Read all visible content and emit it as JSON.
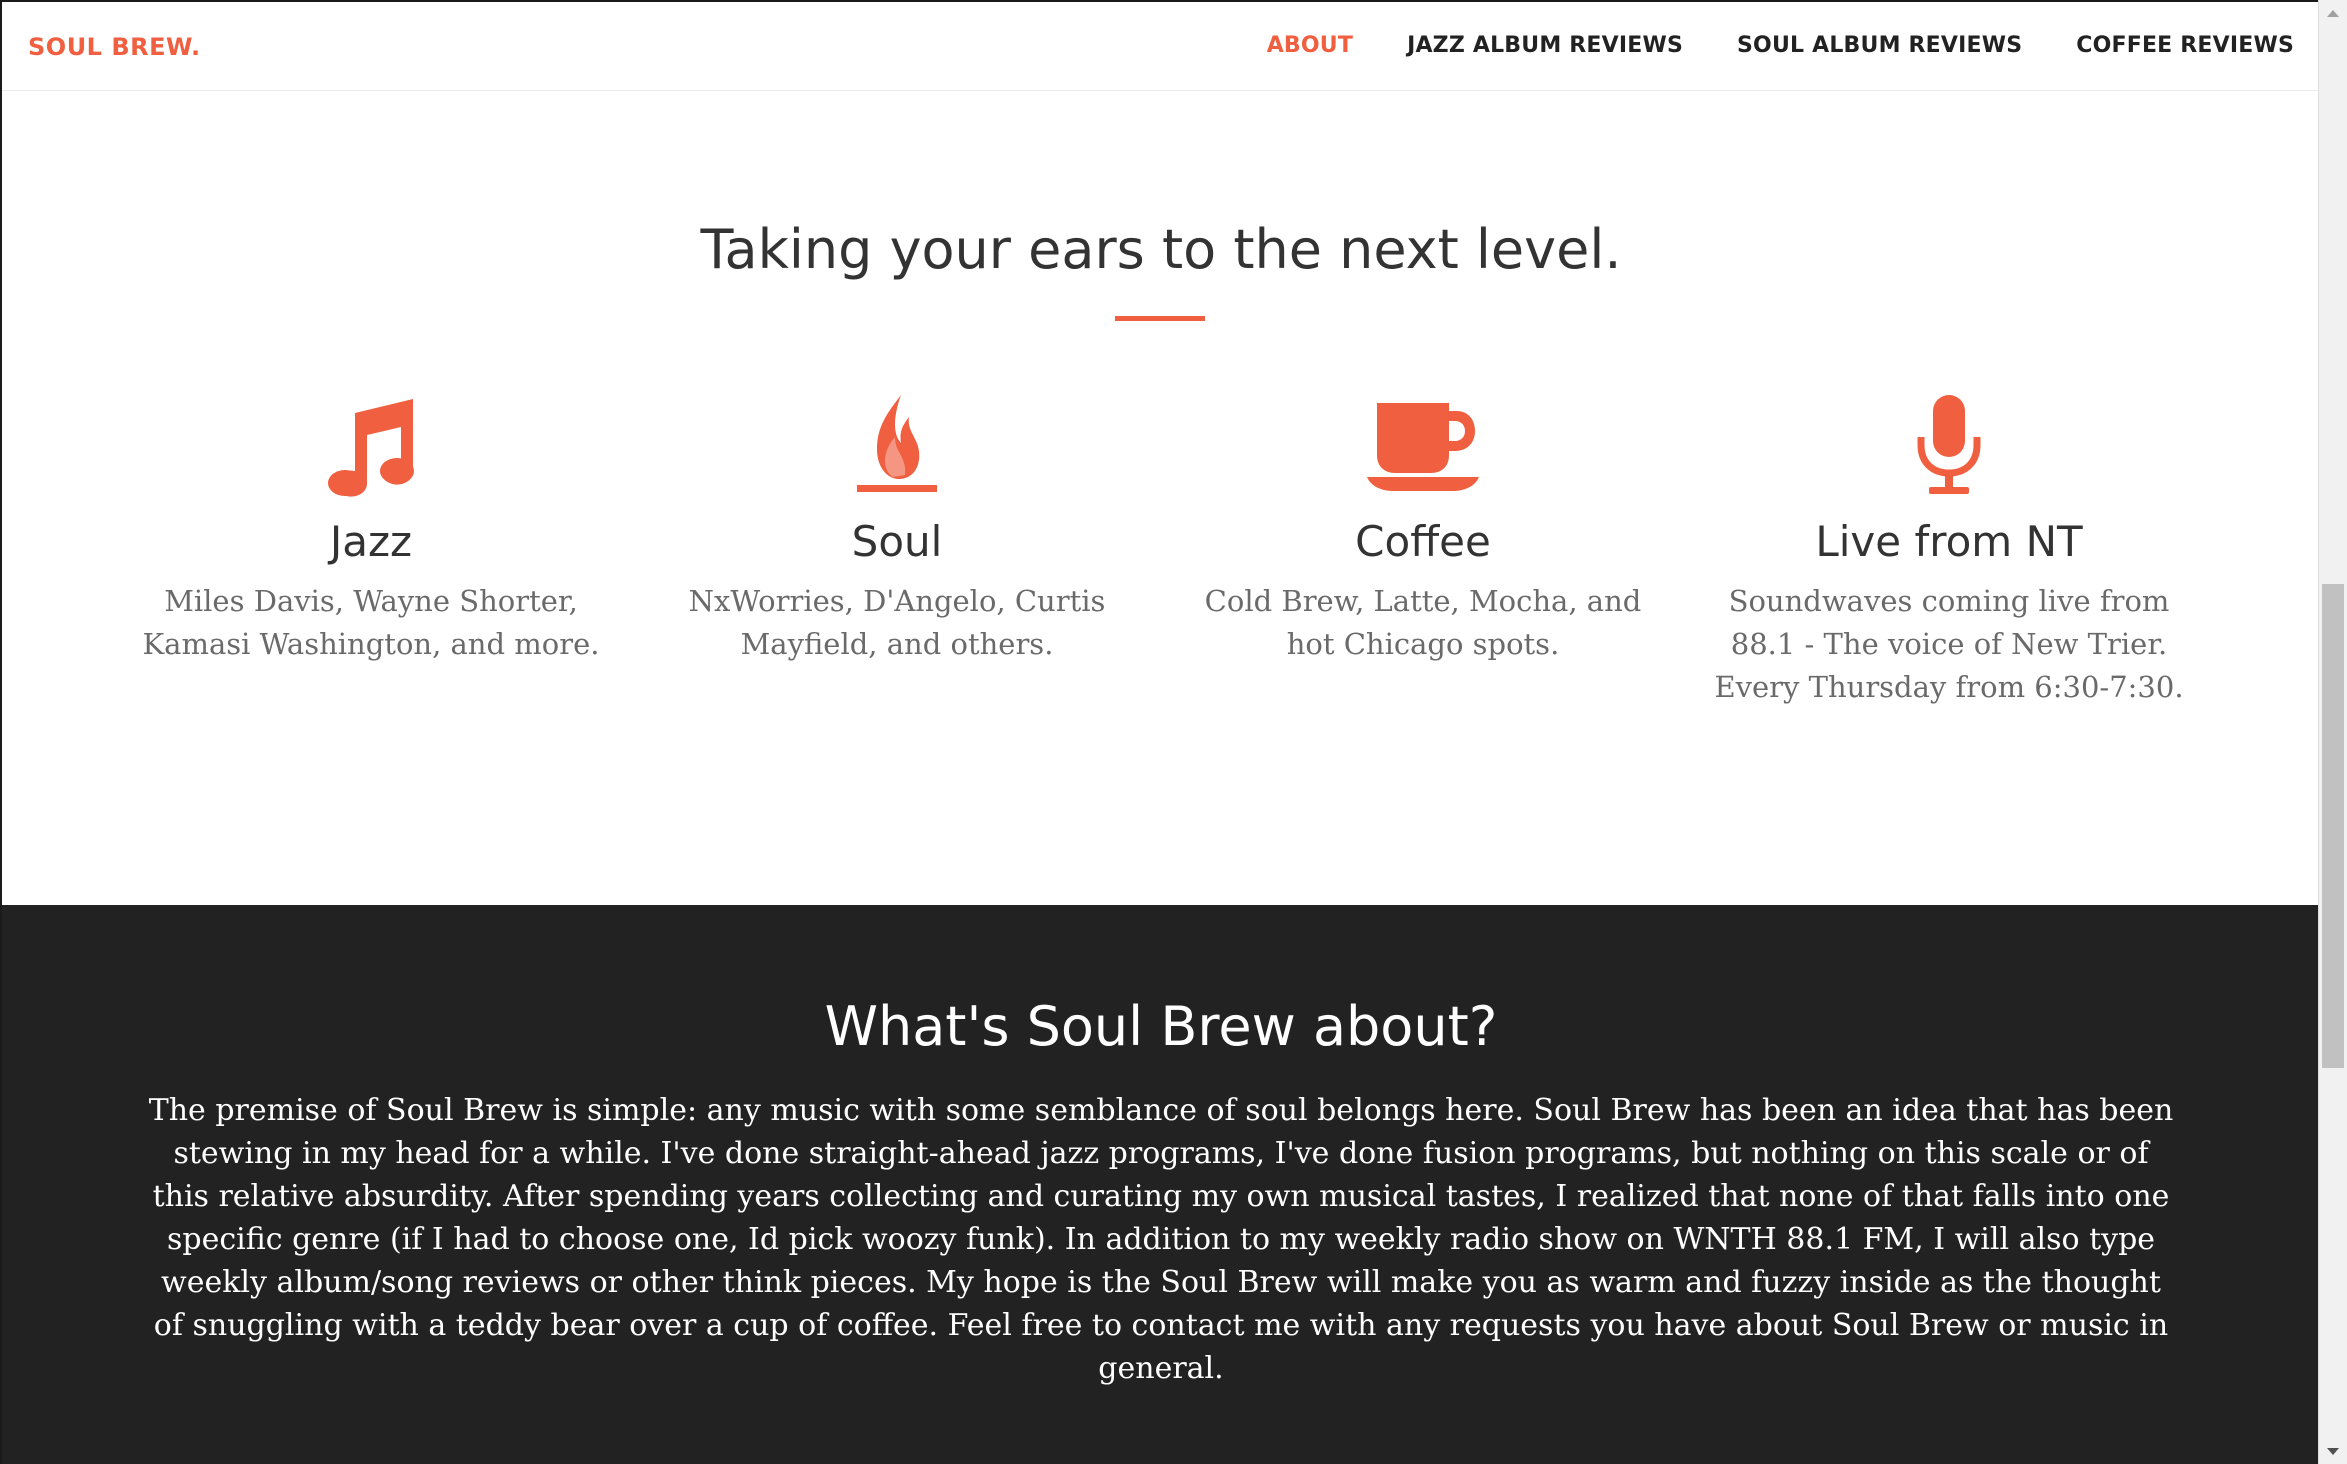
{
  "nav": {
    "brand": "SOUL BREW.",
    "links": [
      {
        "label": "ABOUT",
        "active": true
      },
      {
        "label": "JAZZ ALBUM REVIEWS",
        "active": false
      },
      {
        "label": "SOUL ALBUM REVIEWS",
        "active": false
      },
      {
        "label": "COFFEE REVIEWS",
        "active": false
      }
    ]
  },
  "services": {
    "headline": "Taking your ears to the next level.",
    "items": [
      {
        "icon": "music-note-icon",
        "title": "Jazz",
        "lines": [
          "Miles Davis, Wayne Shorter,",
          "Kamasi Washington, and more."
        ]
      },
      {
        "icon": "fire-icon",
        "title": "Soul",
        "lines": [
          "NxWorries, D'Angelo, Curtis",
          "Mayfield, and others."
        ]
      },
      {
        "icon": "coffee-cup-icon",
        "title": "Coffee",
        "lines": [
          "Cold Brew, Latte, Mocha, and",
          "hot Chicago spots."
        ]
      },
      {
        "icon": "microphone-icon",
        "title": "Live from NT",
        "lines": [
          "Soundwaves coming live from",
          "88.1 - The voice of New Trier.",
          "Every Thursday from 6:30-7:30."
        ]
      }
    ]
  },
  "about": {
    "heading": "What's Soul Brew about?",
    "body": "The premise of Soul Brew is simple: any music with some semblance of soul belongs here. Soul Brew has been an idea that has been stewing in my head for a while. I've done straight-ahead jazz programs, I've done fusion programs, but nothing on this scale or of this relative absurdity. After spending years collecting and curating my own musical tastes, I realized that none of that falls into one specific genre (if I had to choose one, Id pick woozy funk). In addition to my weekly radio show on WNTH 88.1 FM, I will also type weekly album/song reviews or other think pieces. My hope is the Soul Brew will make you as warm and fuzzy inside as the thought of snuggling with a teddy bear over a cup of coffee. Feel free to contact me with any requests you have about Soul Brew or music in general."
  },
  "colors": {
    "accent": "#f05f40",
    "dark_bg": "#222222",
    "text": "#333333",
    "muted": "#6a6a6a"
  }
}
